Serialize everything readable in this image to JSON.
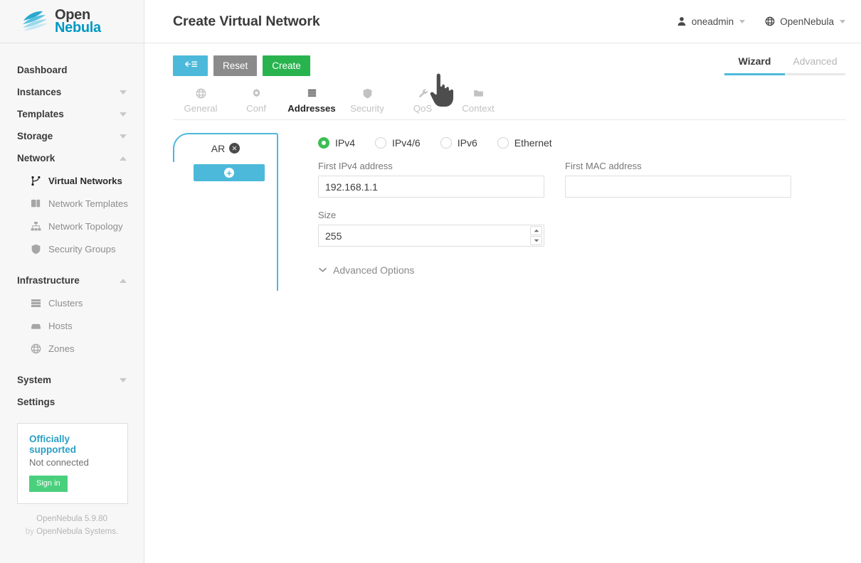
{
  "brand": {
    "logo_open": "Open",
    "logo_nebula": "Nebula",
    "accent_cyan": "#4cb9db",
    "accent_green": "#29b34f",
    "accent_blue": "#0098c3"
  },
  "sidebar": {
    "items": [
      {
        "label": "Dashboard",
        "type": "group",
        "chevron": "none",
        "icon": ""
      },
      {
        "label": "Instances",
        "type": "group",
        "chevron": "down",
        "icon": ""
      },
      {
        "label": "Templates",
        "type": "group",
        "chevron": "down",
        "icon": ""
      },
      {
        "label": "Storage",
        "type": "group",
        "chevron": "down",
        "icon": ""
      },
      {
        "label": "Network",
        "type": "group",
        "chevron": "up",
        "icon": ""
      }
    ],
    "network_children": [
      {
        "label": "Virtual Networks",
        "icon": "network-branch-icon",
        "active": true
      },
      {
        "label": "Network Templates",
        "icon": "copy-layers-icon",
        "active": false
      },
      {
        "label": "Network Topology",
        "icon": "sitemap-icon",
        "active": false
      },
      {
        "label": "Security Groups",
        "icon": "shield-icon",
        "active": false
      }
    ],
    "infrastructure": {
      "label": "Infrastructure",
      "chevron": "up"
    },
    "infrastructure_children": [
      {
        "label": "Clusters",
        "icon": "server-stack-icon"
      },
      {
        "label": "Hosts",
        "icon": "hard-drive-icon"
      },
      {
        "label": "Zones",
        "icon": "globe-icon"
      }
    ],
    "system": {
      "label": "System",
      "chevron": "down"
    },
    "settings": {
      "label": "Settings",
      "chevron": "none"
    },
    "support": {
      "title": "Officially supported",
      "status": "Not connected",
      "signin_label": "Sign in"
    },
    "footer": {
      "version": "OpenNebula 5.9.80",
      "by_prefix": "by",
      "by_company": "OpenNebula Systems."
    }
  },
  "header": {
    "title": "Create Virtual Network",
    "user": {
      "name": "oneadmin",
      "icon": "user-icon"
    },
    "zone": {
      "name": "OpenNebula",
      "icon": "globe-icon"
    }
  },
  "toolbar": {
    "back_label": "",
    "back_icon": "arrow-left-list-icon",
    "reset_label": "Reset",
    "create_label": "Create"
  },
  "mode_tabs": [
    {
      "label": "Wizard",
      "active": true
    },
    {
      "label": "Advanced",
      "active": false
    }
  ],
  "step_tabs": [
    {
      "label": "General",
      "icon": "globe-icon",
      "active": false
    },
    {
      "label": "Conf",
      "icon": "gear-icon",
      "active": false
    },
    {
      "label": "Addresses",
      "icon": "list-lines-icon",
      "active": true
    },
    {
      "label": "Security",
      "icon": "shield-icon",
      "active": false
    },
    {
      "label": "QoS",
      "icon": "wrench-icon",
      "active": false
    },
    {
      "label": "Context",
      "icon": "folder-icon",
      "active": false
    }
  ],
  "ar_panel": {
    "tab_label": "AR",
    "close_icon": "close-circle-icon",
    "add_icon": "plus-circle-icon",
    "add_label": ""
  },
  "form": {
    "address_types": [
      {
        "label": "IPv4",
        "checked": true
      },
      {
        "label": "IPv4/6",
        "checked": false
      },
      {
        "label": "IPv6",
        "checked": false
      },
      {
        "label": "Ethernet",
        "checked": false
      }
    ],
    "first_ipv4": {
      "label": "First IPv4 address",
      "value": "192.168.1.1",
      "placeholder": ""
    },
    "first_mac": {
      "label": "First MAC address",
      "value": "",
      "placeholder": ""
    },
    "size": {
      "label": "Size",
      "value": "255",
      "placeholder": ""
    },
    "advanced_options": {
      "label": "Advanced Options",
      "icon": "chevron-down-icon"
    }
  }
}
